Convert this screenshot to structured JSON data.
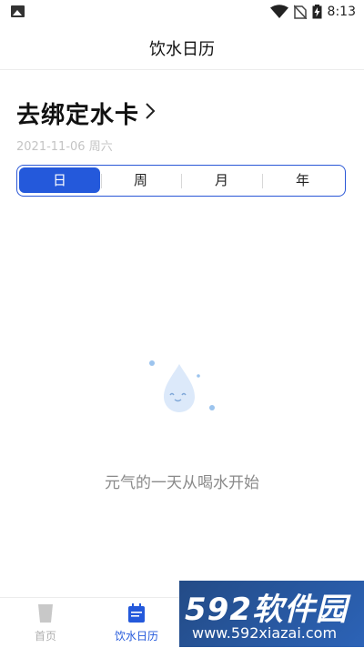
{
  "status_bar": {
    "time": "8:13"
  },
  "header": {
    "title": "饮水日历"
  },
  "bind_card": {
    "title": "去绑定水卡",
    "date": "2021-11-06",
    "weekday": "周六"
  },
  "period_tabs": [
    {
      "label": "日",
      "active": true
    },
    {
      "label": "周",
      "active": false
    },
    {
      "label": "月",
      "active": false
    },
    {
      "label": "年",
      "active": false
    }
  ],
  "empty_state": {
    "message": "元气的一天从喝水开始"
  },
  "bottom_nav": [
    {
      "label": "首页",
      "icon": "cup-icon",
      "active": false
    },
    {
      "label": "饮水日历",
      "icon": "calendar-icon",
      "active": true
    }
  ],
  "watermark": {
    "logo": "592软件园",
    "url": "www.592xiazai.com"
  },
  "colors": {
    "accent": "#2459db",
    "inactive": "#b0b0b0",
    "watermark_bg": "#2c63b7"
  }
}
